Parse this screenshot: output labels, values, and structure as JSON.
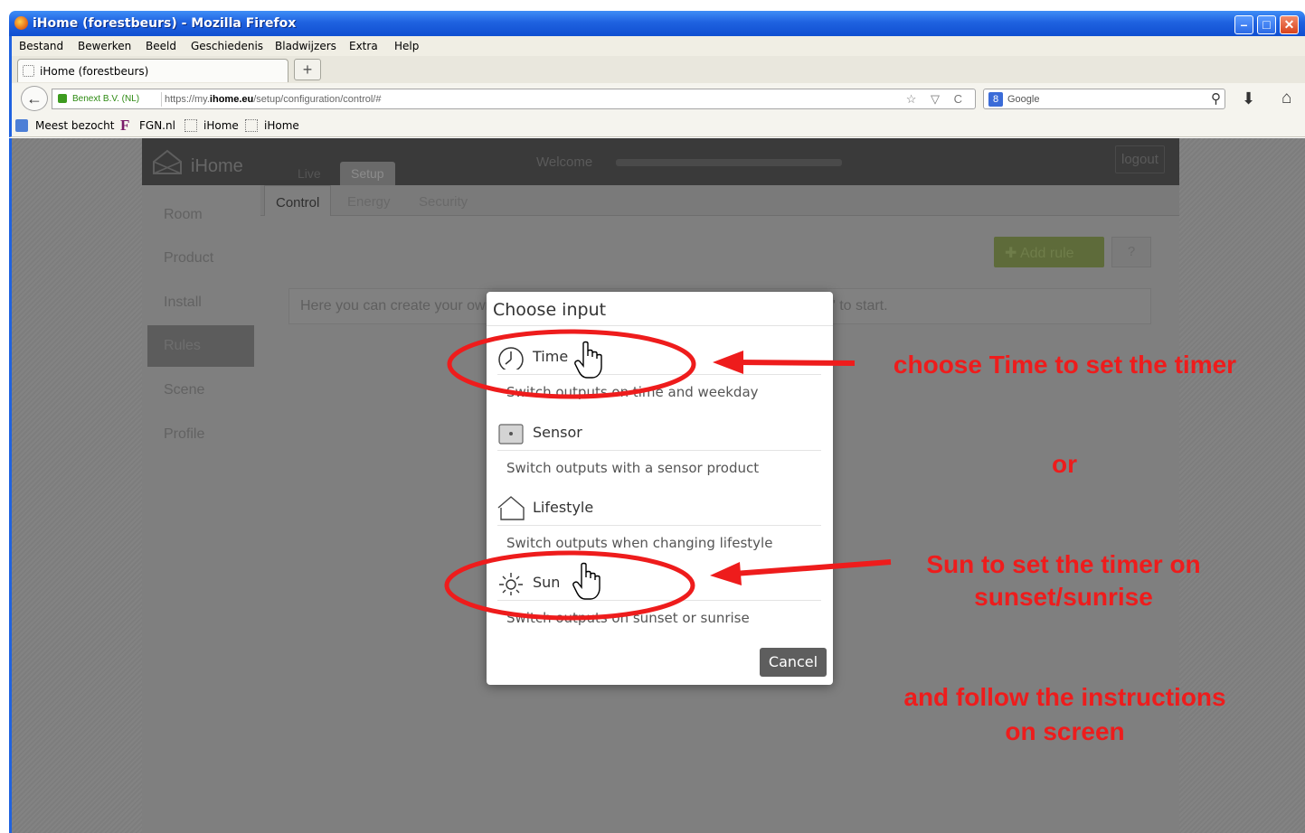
{
  "window": {
    "title": "iHome (forestbeurs) - Mozilla Firefox",
    "controls": [
      "–",
      "□",
      "✕"
    ]
  },
  "menubar": {
    "items": [
      "Bestand",
      "Bewerken",
      "Beeld",
      "Geschiedenis",
      "Bladwijzers",
      "Extra",
      "Help"
    ]
  },
  "tabs": {
    "active_label": "iHome (forestbeurs)",
    "new_tab_label": "+"
  },
  "navbar": {
    "identity": "Benext B.V. (NL)",
    "url_prefix": "https://my.",
    "url_domain": "ihome.eu",
    "url_path": "/setup/configuration/control/#",
    "search_placeholder": "Google",
    "back_glyph": "←",
    "download_glyph": "⬇",
    "home_glyph": "⌂",
    "search_glyph": "⚲",
    "url_icons": "☆ ▽ C",
    "engine_glyph": "8"
  },
  "bookmarks": {
    "items": [
      "Meest bezocht",
      "FGN.nl",
      "iHome",
      "iHome"
    ]
  },
  "app": {
    "logo": "iHome",
    "main_tabs": [
      "Live",
      "Setup"
    ],
    "welcome": "Welcome",
    "logout": "logout",
    "sub_tabs": [
      "Control",
      "Energy",
      "Security"
    ],
    "left_nav": [
      "Room",
      "Product",
      "Install",
      "Rules",
      "Scene",
      "Profile"
    ],
    "add_rule": "✚ Add rule",
    "help": "?",
    "info_text": "Here you can create your own rules to switch outputs automatically. Click \"Add rule\" to start."
  },
  "modal": {
    "title": "Choose input",
    "options": [
      {
        "title": "Time",
        "description": "Switch outputs on time and weekday",
        "icon": "clock-icon"
      },
      {
        "title": "Sensor",
        "description": "Switch outputs with a sensor product",
        "icon": "sensor-icon"
      },
      {
        "title": "Lifestyle",
        "description": "Switch outputs when changing lifestyle",
        "icon": "house-icon"
      },
      {
        "title": "Sun",
        "description": "Switch outputs on sunset or sunrise",
        "icon": "sun-icon"
      }
    ],
    "cancel": "Cancel"
  },
  "annotations": {
    "time_note": "choose Time to set the timer",
    "or": "or",
    "sun_note_1": "Sun to set the timer on",
    "sun_note_2": "sunset/sunrise",
    "follow_1": "and follow the instructions",
    "follow_2": "on screen",
    "color": "#ee1c1c"
  }
}
